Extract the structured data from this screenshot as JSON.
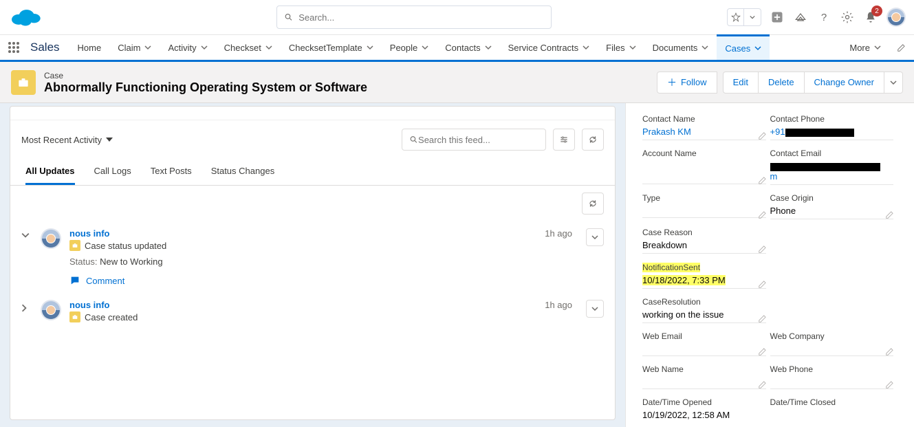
{
  "global": {
    "search_placeholder": "Search...",
    "notif_count": "2"
  },
  "nav": {
    "app_name": "Sales",
    "items": [
      "Home",
      "Claim",
      "Activity",
      "Checkset",
      "ChecksetTemplate",
      "People",
      "Contacts",
      "Service Contracts",
      "Files",
      "Documents",
      "Cases"
    ],
    "more": "More"
  },
  "record": {
    "type": "Case",
    "title": "Abnormally Functioning Operating System or Software",
    "actions": {
      "follow": "Follow",
      "edit": "Edit",
      "delete": "Delete",
      "change_owner": "Change Owner"
    }
  },
  "feed": {
    "sort_label": "Most Recent Activity",
    "search_placeholder": "Search this feed...",
    "tabs": [
      "All Updates",
      "Call Logs",
      "Text Posts",
      "Status Changes"
    ],
    "items": [
      {
        "user": "nous info",
        "headline": "Case status updated",
        "status_label": "Status:",
        "status_value": "New to Working",
        "comment_label": "Comment",
        "time": "1h ago"
      },
      {
        "user": "nous info",
        "headline": "Case created",
        "time": "1h ago"
      }
    ]
  },
  "sidebar": {
    "contact_name": {
      "label": "Contact Name",
      "value": "Prakash KM"
    },
    "contact_phone": {
      "label": "Contact Phone",
      "value_prefix": "+91"
    },
    "account_name": {
      "label": "Account Name",
      "value": ""
    },
    "contact_email": {
      "label": "Contact Email",
      "value_suffix": "m"
    },
    "type": {
      "label": "Type",
      "value": ""
    },
    "case_origin": {
      "label": "Case Origin",
      "value": "Phone"
    },
    "case_reason": {
      "label": "Case Reason",
      "value": "Breakdown"
    },
    "notification_sent": {
      "label": "NotificationSent",
      "value": "10/18/2022, 7:33 PM"
    },
    "case_resolution": {
      "label": "CaseResolution",
      "value": "working on the issue"
    },
    "web_email": {
      "label": "Web Email",
      "value": ""
    },
    "web_company": {
      "label": "Web Company",
      "value": ""
    },
    "web_name": {
      "label": "Web Name",
      "value": ""
    },
    "web_phone": {
      "label": "Web Phone",
      "value": ""
    },
    "datetime_opened": {
      "label": "Date/Time Opened",
      "value": "10/19/2022, 12:58 AM"
    },
    "datetime_closed": {
      "label": "Date/Time Closed",
      "value": ""
    }
  }
}
